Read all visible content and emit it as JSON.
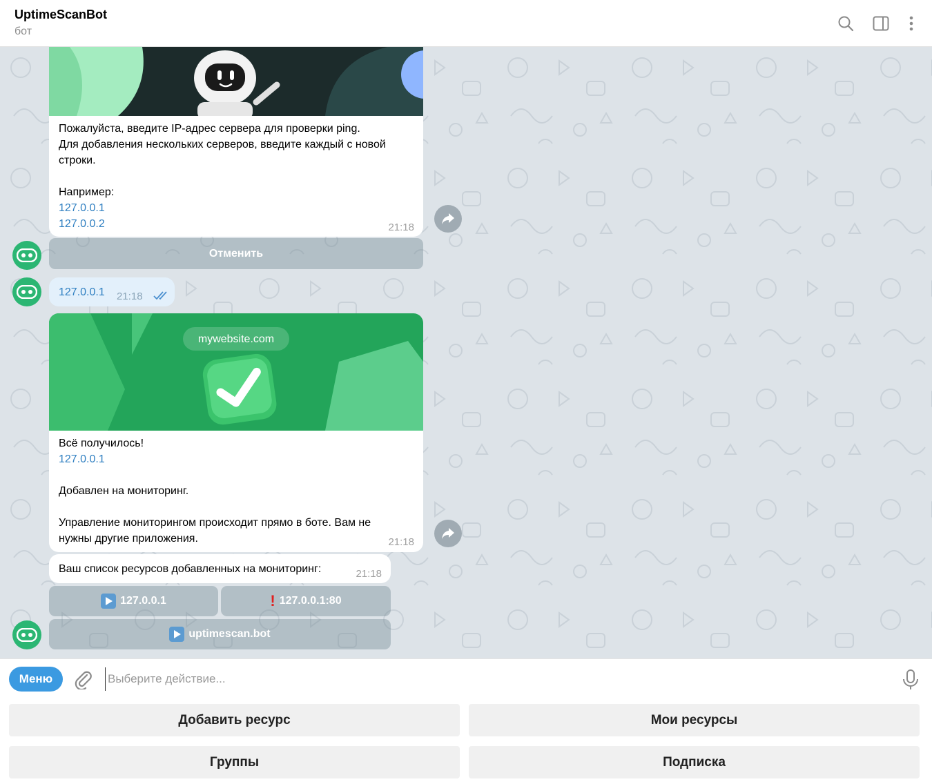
{
  "header": {
    "title": "UptimeScanBot",
    "subtitle": "бот",
    "icons": [
      "search-icon",
      "sidebar-toggle-icon",
      "more-vertical-icon"
    ]
  },
  "messages": {
    "m1": {
      "text_line1": "Пожалуйста, введите IP-адрес сервера для проверки ping.",
      "text_line2": "Для добавления нескольких серверов, введите каждый с новой строки.",
      "example_label": "Например:",
      "example_ip1": "127.0.0.1",
      "example_ip2": "127.0.0.2",
      "time": "21:18",
      "cancel_button": "Отменить"
    },
    "m2": {
      "text": "127.0.0.1",
      "time": "21:18"
    },
    "m3": {
      "banner_domain": "mywebsite.com",
      "line1": "Всё получилось!",
      "ip": "127.0.0.1",
      "line2": "Добавлен на мониторинг.",
      "line3": "Управление мониторингом происходит прямо в боте. Вам не нужны другие приложения.",
      "time": "21:18"
    },
    "m4": {
      "text": "Ваш список ресурсов добавленных на мониторинг:",
      "time": "21:18",
      "buttons": {
        "b1": "127.0.0.1",
        "b2": "127.0.0.1:80",
        "b3": "uptimescan.bot"
      }
    }
  },
  "input": {
    "menu_label": "Меню",
    "placeholder": "Выберите действие..."
  },
  "reply_keyboard": {
    "add_resource": "Добавить ресурс",
    "my_resources": "Мои ресурсы",
    "groups": "Группы",
    "subscription": "Подписка"
  },
  "colors": {
    "accent": "#3b9ae1",
    "bot_avatar": "#2bb673",
    "link": "#2f7fc1",
    "chat_bg": "#dde3e8"
  }
}
